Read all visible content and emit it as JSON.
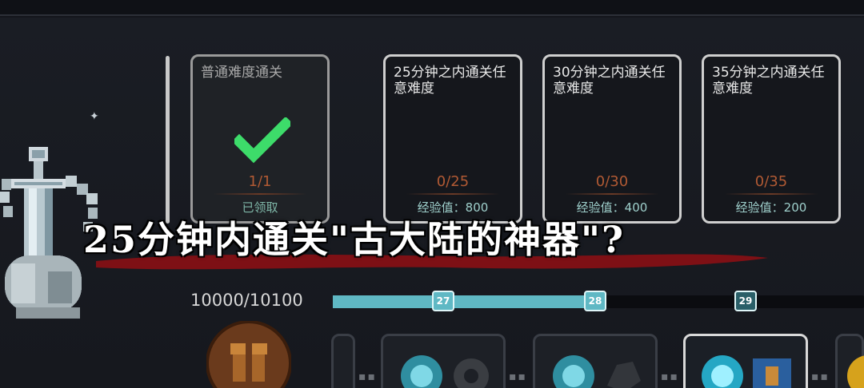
{
  "tasks": [
    {
      "title": "普通难度通关",
      "progress": "1/1",
      "reward": "已领取",
      "completed": true
    },
    {
      "title": "25分钟之内通关任意难度",
      "progress": "0/25",
      "reward": "经验值：800",
      "completed": false
    },
    {
      "title": "30分钟之内通关任意难度",
      "progress": "0/30",
      "reward": "经验值：400",
      "completed": false
    },
    {
      "title": "35分钟之内通关任意难度",
      "progress": "0/35",
      "reward": "经验值：200",
      "completed": false
    }
  ],
  "caption": "25分钟内通关\"古大陆的神器\"?",
  "experience": {
    "text": "10000/10100",
    "fill_fraction": 0.5,
    "levels": [
      "27",
      "28",
      "29"
    ]
  },
  "colors": {
    "accent": "#5fb8c4",
    "progress": "#b15a34",
    "check": "#3ddc6a"
  },
  "icons": [
    "sword-artifact-icon",
    "check-icon",
    "gift-icon",
    "orb-icon",
    "gear-icon"
  ]
}
